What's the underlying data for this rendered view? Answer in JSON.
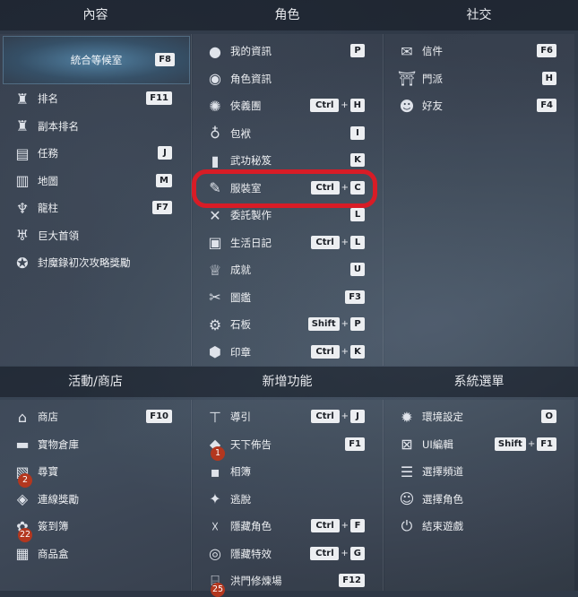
{
  "headers_top": [
    "內容",
    "角色",
    "社交"
  ],
  "headers_bottom": [
    "活動/商店",
    "新增功能",
    "系統選單"
  ],
  "content": {
    "featured": {
      "label": "統合等候室",
      "key": "F8"
    },
    "items": [
      {
        "label": "排名",
        "icon": "ranking-icon",
        "keys": [
          "F11"
        ]
      },
      {
        "label": "副本排名",
        "icon": "dungeon-ranking-icon",
        "keys": []
      },
      {
        "label": "任務",
        "icon": "quest-icon",
        "keys": [
          "J"
        ]
      },
      {
        "label": "地圖",
        "icon": "map-icon",
        "keys": [
          "M"
        ]
      },
      {
        "label": "龍柱",
        "icon": "dragon-pillar-icon",
        "keys": [
          "F7"
        ]
      },
      {
        "label": "巨大首領",
        "icon": "giant-boss-icon",
        "keys": []
      },
      {
        "label": "封魔錄初次攻略獎勵",
        "icon": "seal-record-icon",
        "keys": []
      }
    ]
  },
  "character": {
    "items": [
      {
        "label": "我的資訊",
        "icon": "my-info-icon",
        "keys": [
          "P"
        ]
      },
      {
        "label": "角色資訊",
        "icon": "character-info-icon",
        "keys": []
      },
      {
        "label": "俠義團",
        "icon": "clan-icon",
        "keys": [
          "Ctrl",
          "H"
        ]
      },
      {
        "label": "包袱",
        "icon": "bag-icon",
        "keys": [
          "I"
        ]
      },
      {
        "label": "武功秘笈",
        "icon": "skill-book-icon",
        "keys": [
          "K"
        ]
      },
      {
        "label": "服裝室",
        "icon": "wardrobe-icon",
        "keys": [
          "Ctrl",
          "C"
        ]
      },
      {
        "label": "委託製作",
        "icon": "crafting-icon",
        "keys": [
          "L"
        ]
      },
      {
        "label": "生活日記",
        "icon": "life-diary-icon",
        "keys": [
          "Ctrl",
          "L"
        ]
      },
      {
        "label": "成就",
        "icon": "achievement-icon",
        "keys": [
          "U"
        ]
      },
      {
        "label": "圖鑑",
        "icon": "collection-icon",
        "keys": [
          "F3"
        ]
      },
      {
        "label": "石板",
        "icon": "stone-tablet-icon",
        "keys": [
          "Shift",
          "P"
        ]
      },
      {
        "label": "印章",
        "icon": "seal-icon",
        "keys": [
          "Ctrl",
          "K"
        ]
      }
    ]
  },
  "social": {
    "items": [
      {
        "label": "信件",
        "icon": "mail-icon",
        "keys": [
          "F6"
        ]
      },
      {
        "label": "門派",
        "icon": "faction-icon",
        "keys": [
          "H"
        ]
      },
      {
        "label": "好友",
        "icon": "friends-icon",
        "keys": [
          "F4"
        ]
      }
    ]
  },
  "activity": {
    "items": [
      {
        "label": "商店",
        "icon": "shop-icon",
        "keys": [
          "F10"
        ]
      },
      {
        "label": "寶物倉庫",
        "icon": "treasure-warehouse-icon",
        "keys": []
      },
      {
        "label": "尋寶",
        "icon": "treasure-hunt-icon",
        "keys": [],
        "badge": "2"
      },
      {
        "label": "連線獎勵",
        "icon": "online-reward-icon",
        "keys": []
      },
      {
        "label": "簽到簿",
        "icon": "attendance-icon",
        "keys": [],
        "badge": "22"
      },
      {
        "label": "商品盒",
        "icon": "item-box-icon",
        "keys": []
      }
    ]
  },
  "new_features": {
    "items": [
      {
        "label": "導引",
        "icon": "guide-icon",
        "keys": [
          "Ctrl",
          "J"
        ]
      },
      {
        "label": "天下佈告",
        "icon": "announcement-icon",
        "keys": [
          "F1"
        ],
        "badge": "1"
      },
      {
        "label": "相簿",
        "icon": "album-icon",
        "keys": []
      },
      {
        "label": "逃脫",
        "icon": "escape-icon",
        "keys": []
      },
      {
        "label": "隱藏角色",
        "icon": "hide-character-icon",
        "keys": [
          "Ctrl",
          "F"
        ]
      },
      {
        "label": "隱藏特效",
        "icon": "hide-effects-icon",
        "keys": [
          "Ctrl",
          "G"
        ]
      },
      {
        "label": "洪門修煉場",
        "icon": "training-ground-icon",
        "keys": [
          "F12"
        ],
        "badge": "25"
      }
    ]
  },
  "system": {
    "items": [
      {
        "label": "環境設定",
        "icon": "settings-icon",
        "keys": [
          "O"
        ]
      },
      {
        "label": "UI編輯",
        "icon": "ui-edit-icon",
        "keys": [
          "Shift",
          "F1"
        ]
      },
      {
        "label": "選擇頻道",
        "icon": "channel-select-icon",
        "keys": []
      },
      {
        "label": "選擇角色",
        "icon": "character-select-icon",
        "keys": []
      },
      {
        "label": "結束遊戲",
        "icon": "exit-game-icon",
        "keys": []
      }
    ]
  },
  "colors": {
    "highlight_ring": "#d81c26",
    "badge": "#b3371f",
    "key_bg": "#eceef1"
  }
}
